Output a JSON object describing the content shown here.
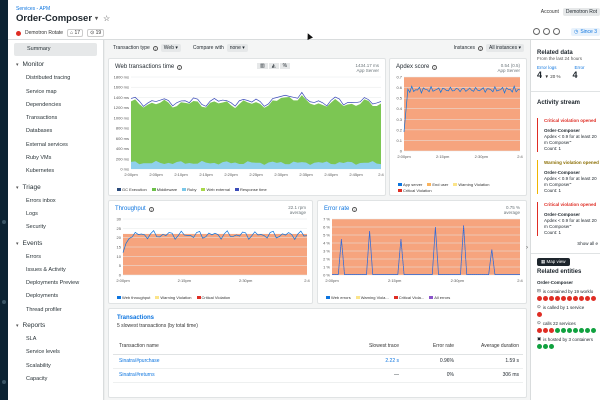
{
  "header": {
    "breadcrumb": "Services - APM",
    "title": "Order-Composer",
    "tag_name": "Demotron Rotate",
    "tag_count_1": "17",
    "tag_count_2": "19",
    "account_label": "Account",
    "account_value": "Demotron Rot",
    "since_label": "Since 3"
  },
  "sidebar": {
    "summary": "Summary",
    "sections": [
      {
        "title": "Monitor",
        "items": [
          "Distributed tracing",
          "Service map",
          "Dependencies",
          "Transactions",
          "Databases",
          "External services",
          "Ruby VMs",
          "Kubernetes"
        ]
      },
      {
        "title": "Triage",
        "items": [
          "Errors inbox",
          "Logs",
          "Security"
        ]
      },
      {
        "title": "Events",
        "items": [
          "Errors",
          "Issues & Activity",
          "Deployments Preview",
          "Deployments",
          "Thread profiler"
        ]
      },
      {
        "title": "Reports",
        "items": [
          "SLA",
          "Service levels",
          "Scalability",
          "Capacity"
        ]
      }
    ]
  },
  "toolbar": {
    "transaction_type_label": "Transaction type",
    "transaction_type_value": "Web",
    "compare_label": "Compare with",
    "compare_value": "none",
    "instances_label": "Instances",
    "instances_value": "All instances"
  },
  "web_time": {
    "title": "Web transactions time",
    "stat_value": "1434.17 ms",
    "stat_label": "App Server",
    "y_ticks": [
      "1800 ms",
      "1600 ms",
      "1400 ms",
      "1200 ms",
      "1000 ms",
      "800 ms",
      "600 ms",
      "400 ms",
      "200 ms",
      "0 ms"
    ],
    "x_ticks": [
      "2:00pm",
      "2:05pm",
      "2:10pm",
      "2:15pm",
      "2:20pm",
      "2:25pm",
      "2:30pm",
      "2:35pm",
      "2:40pm",
      "2:45pm",
      "2:4"
    ],
    "legend": [
      "GC Execution",
      "Middleware",
      "Ruby",
      "Web external",
      "Response time"
    ],
    "legend_colors": [
      "#2b4a7a",
      "#6cc04a",
      "#7ac7e8",
      "#a8d84a",
      "#3b4cb8"
    ]
  },
  "apdex": {
    "title": "Apdex score",
    "stat_value": "0.54 (0.5)",
    "stat_label": "App Server",
    "y_ticks": [
      "0.7",
      "0.6",
      "0.5",
      "0.4",
      "0.3",
      "0.2",
      "0.1",
      "0"
    ],
    "x_ticks": [
      "2:00pm",
      "2:15pm",
      "2:30pm",
      "2:4"
    ],
    "legend": [
      "App server",
      "End user",
      "Warning Violation",
      "Critical Violation"
    ]
  },
  "throughput": {
    "title": "Throughput",
    "stat_value": "22.1 rpm",
    "stat_label": "average",
    "y_ticks": [
      "30",
      "25",
      "20",
      "15",
      "10",
      "5",
      "0"
    ],
    "x_ticks": [
      "2:00pm",
      "2:15pm",
      "2:30pm",
      "2:4"
    ],
    "legend": [
      "Web throughput",
      "Warning Violation",
      "Critical Violation"
    ]
  },
  "error_rate": {
    "title": "Error rate",
    "stat_value": "0.75 %",
    "stat_label": "average",
    "y_ticks": [
      "7 %",
      "6 %",
      "5 %",
      "4 %",
      "3 %",
      "2 %",
      "1 %",
      "0 %"
    ],
    "x_ticks": [
      "2:00pm",
      "2:15pm",
      "2:30pm",
      "2:4"
    ],
    "legend": [
      "Web errors",
      "Warning Viola...",
      "Critical Viola...",
      "All errors"
    ]
  },
  "transactions": {
    "title": "Transactions",
    "subtitle": "5 slowest transactions (by total time)",
    "columns": [
      "Transaction name",
      "Slowest trace",
      "Error rate",
      "Average duration"
    ],
    "rows": [
      {
        "name": "Sinatra/#purchase",
        "trace": "2.22 s",
        "error": "0.96%",
        "duration": "1.59 s"
      },
      {
        "name": "Sinatra/#returns",
        "trace": "—",
        "error": "0%",
        "duration": "306 ms"
      }
    ]
  },
  "right_panel": {
    "related_title": "Related data",
    "related_sub": "From the last 24 hours",
    "error_logs_label": "Error logs",
    "error_logs_value": "4",
    "error_logs_trend": "20 %",
    "errors_label": "Error",
    "errors_value": "4",
    "activity_title": "Activity stream",
    "activities": [
      {
        "kind": "critical",
        "heading": "Critical violation opened",
        "entity": "Order-Composer",
        "detail": "Apdex < 0.9 for at least 20 m Composer\"",
        "count": "Count: 1"
      },
      {
        "kind": "warning",
        "heading": "Warning violation opened",
        "entity": "Order-Composer",
        "detail": "Apdex < 0.9 for at least 20 m Composer\"",
        "count": "Count: 1"
      },
      {
        "kind": "critical",
        "heading": "Critical violation opened",
        "entity": "Order-Composer",
        "detail": "Apdex < 0.9 for at least 20 m Composer\"",
        "count": "Count: 1"
      }
    ],
    "show_all": "Show all e",
    "map_view": "Map view",
    "entities_title": "Related entities",
    "entity_name": "Order-Composer",
    "rel_contained": "is contained by 19 worklo",
    "rel_called": "is called by 1 service",
    "rel_calls": "calls 22 services",
    "rel_hosted": "is hosted by 3 containers"
  }
}
